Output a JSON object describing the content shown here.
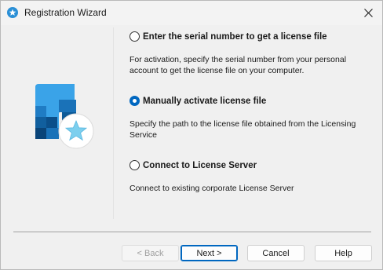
{
  "window": {
    "title": "Registration Wizard",
    "icons": {
      "app": "star-badge-icon",
      "close": "close-icon",
      "logo": "license-logo-icon"
    },
    "colors": {
      "accent": "#0067c0",
      "logo_blue": "#2a8fd6",
      "logo_dark": "#0b4f8a",
      "star": "#7ccfee"
    }
  },
  "options": [
    {
      "label": "Enter the serial number to get a license file",
      "description": "For activation, specify the serial number from your personal account to get the license file on your computer.",
      "selected": false
    },
    {
      "label": "Manually activate license file",
      "description": "Specify the path to the license file obtained from the Licensing Service",
      "selected": true
    },
    {
      "label": "Connect to License Server",
      "description": "Connect to existing corporate License Server",
      "selected": false
    }
  ],
  "buttons": {
    "back": "< Back",
    "next": "Next >",
    "cancel": "Cancel",
    "help": "Help"
  }
}
